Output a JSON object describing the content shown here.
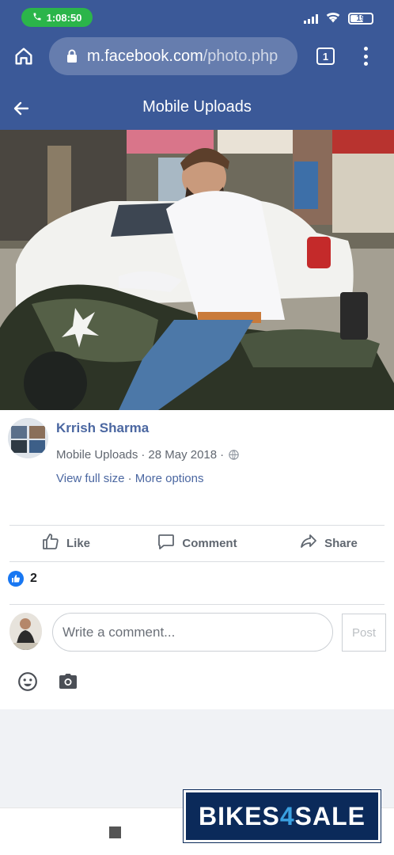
{
  "status_bar": {
    "call_time": "1:08:50",
    "battery": "19"
  },
  "browser": {
    "url_host": "m.facebook.com",
    "url_path": "/photo.php",
    "tab_count": "1"
  },
  "header": {
    "title": "Mobile Uploads"
  },
  "post": {
    "author": "Krrish Sharma",
    "album": "Mobile Uploads",
    "date": "28 May 2018",
    "separator": "·",
    "view_full_size": "View full size",
    "more_options": "More options"
  },
  "actions": {
    "like": "Like",
    "comment": "Comment",
    "share": "Share"
  },
  "reactions": {
    "count": "2"
  },
  "comment_box": {
    "placeholder": "Write a comment...",
    "post_label": "Post"
  },
  "watermark": {
    "part1": "BIKES",
    "part2": "4",
    "part3": "SALE"
  },
  "colors": {
    "brand": "#3b5998",
    "link": "#4b67a1",
    "like_blue": "#1877f2",
    "call_green": "#2bb54a"
  },
  "icons": [
    "phone-icon",
    "signal-icon",
    "wifi-icon",
    "battery-icon",
    "home-icon",
    "lock-icon",
    "tabs-icon",
    "overflow-menu-icon",
    "back-arrow-icon",
    "globe-icon",
    "like-icon",
    "comment-icon",
    "share-icon",
    "emoji-icon",
    "camera-icon"
  ]
}
